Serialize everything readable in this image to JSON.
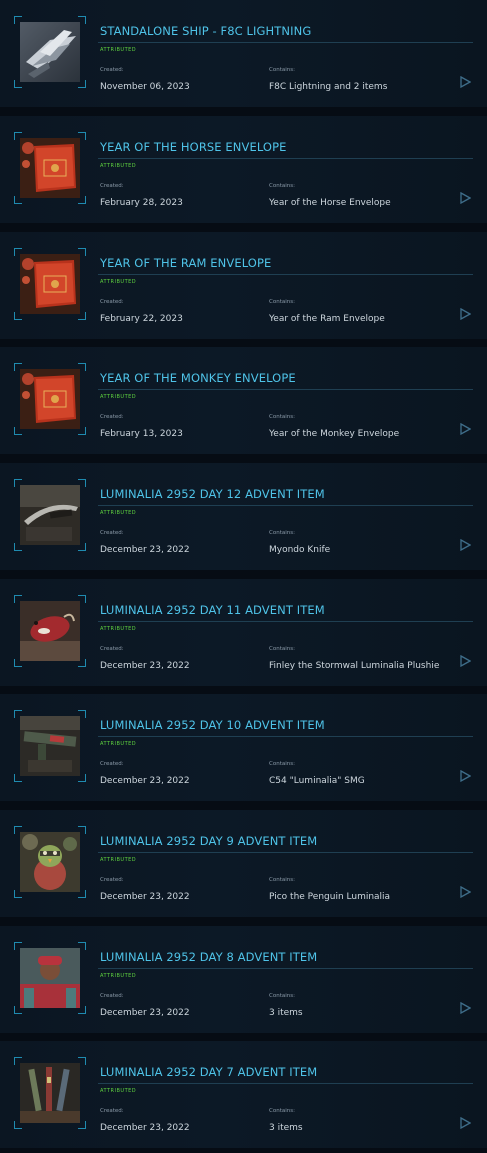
{
  "labels": {
    "created": "Created:",
    "contains": "Contains:"
  },
  "colors": {
    "title": "#4fc3e8",
    "badge": "#5fd33f",
    "frame": "#1f8bb0",
    "row_background": "#0c1926",
    "page_background": "#060c14"
  },
  "items": [
    {
      "title": "STANDALONE SHIP - F8C LIGHTNING",
      "badge": "ATTRIBUTED",
      "created": "November 06, 2023",
      "contains": "F8C Lightning and 2 items",
      "thumb": "ship-thumbnail",
      "open_icon": "play-triangle-icon"
    },
    {
      "title": "YEAR OF THE HORSE ENVELOPE",
      "badge": "ATTRIBUTED",
      "created": "February 28, 2023",
      "contains": "Year of the Horse Envelope",
      "thumb": "red-envelope-thumbnail",
      "open_icon": "play-triangle-icon"
    },
    {
      "title": "YEAR OF THE RAM ENVELOPE",
      "badge": "ATTRIBUTED",
      "created": "February 22, 2023",
      "contains": "Year of the Ram Envelope",
      "thumb": "red-envelope-thumbnail",
      "open_icon": "play-triangle-icon"
    },
    {
      "title": "YEAR OF THE MONKEY ENVELOPE",
      "badge": "ATTRIBUTED",
      "created": "February 13, 2023",
      "contains": "Year of the Monkey Envelope",
      "thumb": "red-envelope-thumbnail",
      "open_icon": "play-triangle-icon"
    },
    {
      "title": "LUMINALIA 2952 DAY 12 ADVENT ITEM",
      "badge": "ATTRIBUTED",
      "created": "December 23, 2022",
      "contains": "Myondo Knife",
      "thumb": "knife-thumbnail",
      "open_icon": "play-triangle-icon"
    },
    {
      "title": "LUMINALIA 2952 DAY 11 ADVENT ITEM",
      "badge": "ATTRIBUTED",
      "created": "December 23, 2022",
      "contains": "Finley the Stormwal Luminalia Plushie",
      "thumb": "plushie-thumbnail",
      "open_icon": "play-triangle-icon"
    },
    {
      "title": "LUMINALIA 2952 DAY 10 ADVENT ITEM",
      "badge": "ATTRIBUTED",
      "created": "December 23, 2022",
      "contains": "C54 \"Luminalia\" SMG",
      "thumb": "smg-thumbnail",
      "open_icon": "play-triangle-icon"
    },
    {
      "title": "LUMINALIA 2952 DAY 9 ADVENT ITEM",
      "badge": "ATTRIBUTED",
      "created": "December 23, 2022",
      "contains": "Pico the Penguin Luminalia",
      "thumb": "penguin-thumbnail",
      "open_icon": "play-triangle-icon"
    },
    {
      "title": "LUMINALIA 2952 DAY 8 ADVENT ITEM",
      "badge": "ATTRIBUTED",
      "created": "December 23, 2022",
      "contains": "3 items",
      "thumb": "outfit-thumbnail",
      "open_icon": "play-triangle-icon"
    },
    {
      "title": "LUMINALIA 2952 DAY 7 ADVENT ITEM",
      "badge": "ATTRIBUTED",
      "created": "December 23, 2022",
      "contains": "3 items",
      "thumb": "weapons-thumbnail",
      "open_icon": "play-triangle-icon"
    }
  ]
}
